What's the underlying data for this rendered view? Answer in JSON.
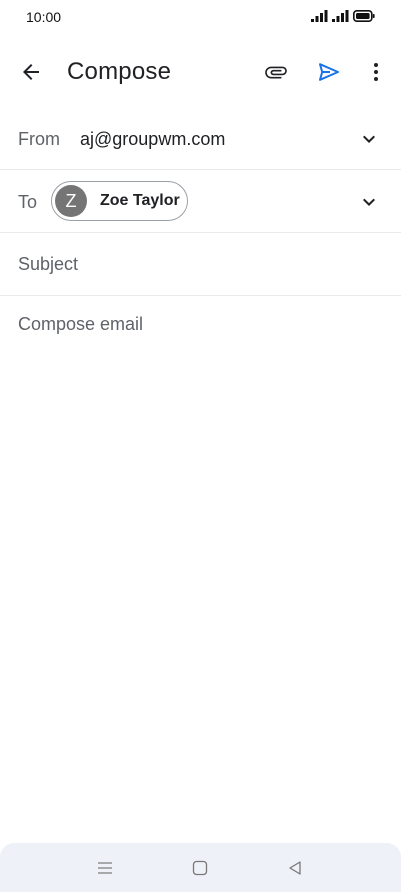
{
  "status_bar": {
    "time": "10:00",
    "icons": [
      "signal-icon",
      "signal-icon",
      "battery-icon"
    ]
  },
  "app_bar": {
    "title": "Compose",
    "icons": {
      "back": "arrow-left-icon",
      "attach": "paperclip-icon",
      "send": "send-icon",
      "more": "more-vert-icon"
    },
    "accent_color": "#1a73e8"
  },
  "fields": {
    "from": {
      "label": "From",
      "value": "aj@groupwm.com"
    },
    "to": {
      "label": "To",
      "recipients": [
        {
          "initial": "Z",
          "name": "Zoe Taylor"
        }
      ]
    },
    "subject": {
      "placeholder": "Subject"
    },
    "body": {
      "placeholder": "Compose email"
    }
  },
  "nav_bar": {
    "icons": [
      "menu-icon",
      "home-icon",
      "back-triangle-icon"
    ]
  }
}
